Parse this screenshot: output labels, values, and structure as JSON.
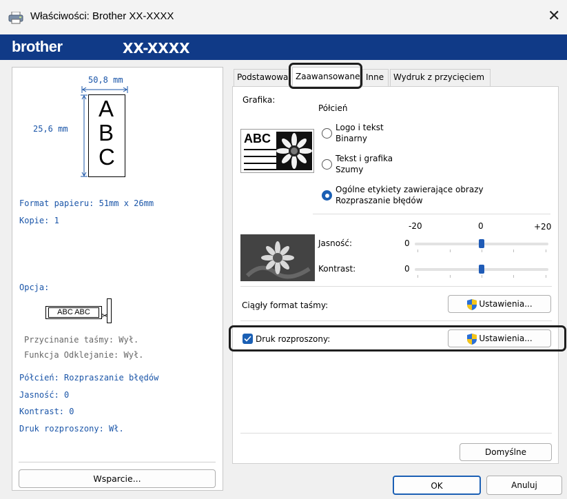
{
  "window": {
    "title": "Właściwości: Brother XX-XXXX",
    "close_icon": "close-icon"
  },
  "brand": {
    "logo": "brother",
    "model": "XX-XXXX"
  },
  "preview": {
    "width_label": "50,8 mm",
    "height_label": "25,6 mm",
    "letters": [
      "A",
      "B",
      "C"
    ],
    "paper_format": "Format papieru: 51mm x 26mm",
    "copies": "Kopie: 1",
    "option_label": "Opcja:",
    "cutter_sample": "ABC ABC",
    "cut_tape": "Przycinanie taśmy: Wył.",
    "peel_function": "Funkcja Odklejanie: Wył.",
    "halftone": "Półcień: Rozpraszanie błędów",
    "brightness": "Jasność:  0",
    "contrast": "Kontrast:  0",
    "distributed": "Druk rozproszony: Wł.",
    "support_button": "Wsparcie..."
  },
  "tabs": [
    {
      "label": "Podstawowa"
    },
    {
      "label": "Zaawansowane",
      "active": true
    },
    {
      "label": "Inne"
    },
    {
      "label": "Wydruk z przycięciem"
    }
  ],
  "advanced": {
    "graphics_label": "Grafika:",
    "halftone_label": "Półcień",
    "sample_text": "ABC",
    "radios": [
      {
        "line1": "Logo i tekst",
        "line2": "Binarny",
        "selected": false
      },
      {
        "line1": "Tekst i grafika",
        "line2": "Szumy",
        "selected": false
      },
      {
        "line1": "Ogólne etykiety zawierające obrazy",
        "line2": "Rozpraszanie błędów",
        "selected": true
      }
    ],
    "scale": {
      "min": "-20",
      "mid": "0",
      "max": "+20"
    },
    "brightness": {
      "label": "Jasność:",
      "value": "0",
      "level": 0
    },
    "contrast": {
      "label": "Kontrast:",
      "value": "0",
      "level": 0
    },
    "continuous_tape": {
      "label": "Ciągły format taśmy:",
      "button": "Ustawienia..."
    },
    "distributed_print": {
      "label": "Druk rozproszony:",
      "checked": true,
      "button": "Ustawienia..."
    },
    "defaults_button": "Domyślne"
  },
  "footer": {
    "ok": "OK",
    "cancel": "Anuluj"
  },
  "colors": {
    "brand_bar": "#103a87",
    "accent": "#1a5fb4",
    "label_blue": "#1a55a8"
  }
}
